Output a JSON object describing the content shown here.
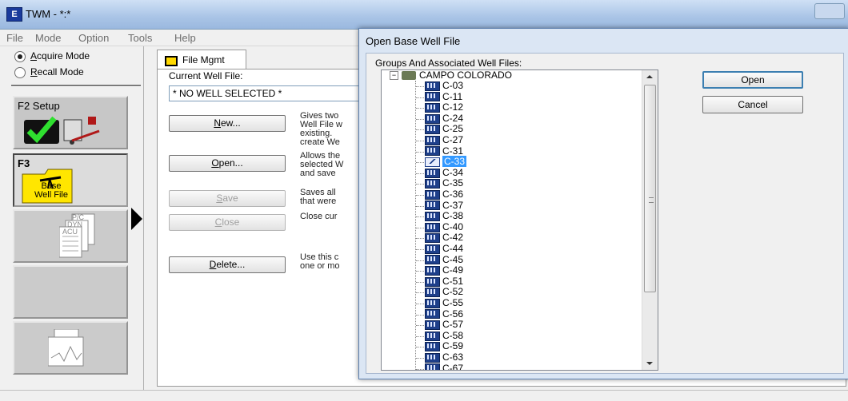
{
  "window": {
    "title": "TWM - *:*"
  },
  "menubar": {
    "items": [
      "File",
      "Mode",
      "Option",
      "Tools",
      "Help"
    ]
  },
  "modes": {
    "acquire": "Acquire Mode",
    "recall": "Recall Mode",
    "selected": "acquire"
  },
  "sidebar": {
    "f2_label": "F2 Setup",
    "f3_label": "F3",
    "f3_sub": [
      "Base",
      "Well File"
    ],
    "acu_labels": [
      "P/C",
      "DYN",
      "ACU"
    ]
  },
  "main": {
    "tab_label": "File Mgmt",
    "current_well_label": "Current Well File:",
    "current_well_value": "* NO WELL SELECTED *",
    "buttons": [
      {
        "label": "New...",
        "enabled": true,
        "desc": "Gives two\nWell File w\nexisting.\ncreate We"
      },
      {
        "label": "Open...",
        "enabled": true,
        "desc": "Allows the\nselected W\nand save"
      },
      {
        "label": "Save",
        "enabled": false,
        "desc": "Saves all\nthat were"
      },
      {
        "label": "Close",
        "enabled": false,
        "desc": "Close cur"
      },
      {
        "label": "Delete...",
        "enabled": true,
        "desc": "Use this c\none or mo"
      }
    ]
  },
  "dialog": {
    "title": "Open Base Well File",
    "group_label": "Groups And Associated Well Files:",
    "group_name": "CAMPO COLORADO",
    "wells": [
      "C-03",
      "C-11",
      "C-12",
      "C-24",
      "C-25",
      "C-27",
      "C-31",
      "C-33",
      "C-34",
      "C-35",
      "C-36",
      "C-37",
      "C-38",
      "C-40",
      "C-42",
      "C-44",
      "C-45",
      "C-49",
      "C-51",
      "C-52",
      "C-55",
      "C-56",
      "C-57",
      "C-58",
      "C-59",
      "C-63",
      "C-67"
    ],
    "selected_well": "C-33",
    "open_label": "Open",
    "cancel_label": "Cancel"
  }
}
